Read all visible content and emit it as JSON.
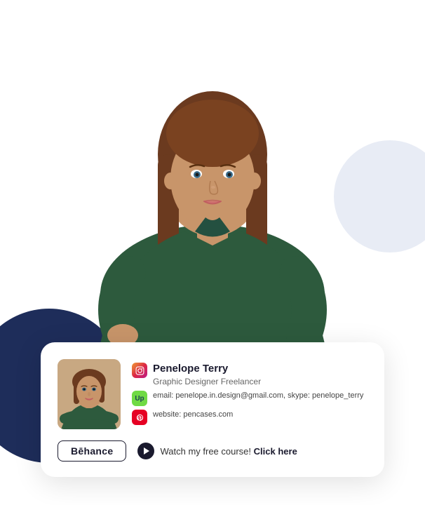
{
  "person": {
    "name": "Penelope Terry",
    "title": "Graphic Designer Freelancer",
    "email": "penelope.in.design@gmail.com",
    "skype": "penelope_terry",
    "website": "pencases.com",
    "detail_line": "email: penelope.in.design@gmail.com, skype: penelope_terry",
    "website_line": "website: pencases.com"
  },
  "card": {
    "behance_label": "Bēhance",
    "course_text": "Watch my free course!",
    "click_here": "Click here"
  },
  "icons": {
    "instagram": "IG",
    "upwork": "Up",
    "pinterest": "P",
    "play": "▶"
  }
}
